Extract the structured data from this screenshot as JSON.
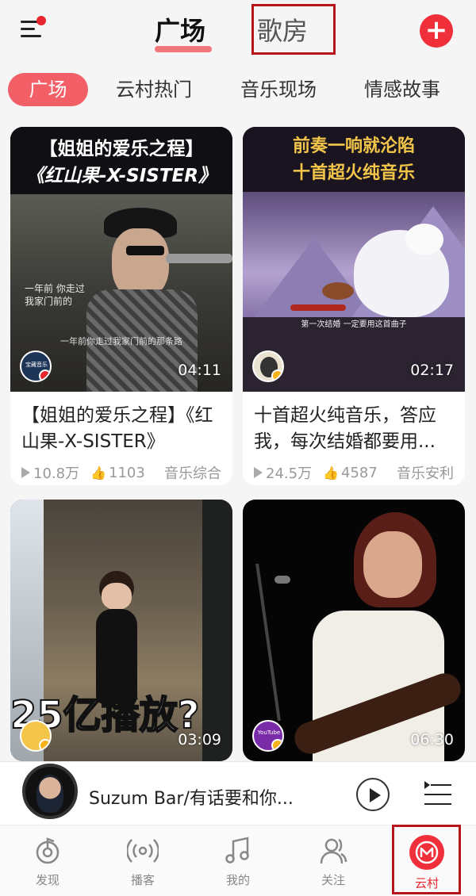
{
  "header": {
    "tab_active": "广场",
    "tab_inactive": "歌房"
  },
  "categories": [
    "广场",
    "云村热门",
    "音乐现场",
    "情感故事"
  ],
  "cards": [
    {
      "overlay_line1": "【姐姐的爱乐之程】",
      "overlay_line2": "《红山果-X-SISTER》",
      "subtitle_lyric1": "一年前 你走过",
      "subtitle_lyric2": "我家门前的",
      "bottom_lyric": "一年前你走过我家门前的那条路",
      "avatar_text": "宝藏音乐",
      "duration": "04:11",
      "title": "【姐姐的爱乐之程】《红山果-X-SISTER》",
      "plays": "10.8万",
      "likes": "1103",
      "category": "音乐综合"
    },
    {
      "overlay_line1": "前奏一响就沦陷",
      "overlay_line2": "十首超火纯音乐",
      "bottom_lyric": "第一次结婚 一定要用这首曲子",
      "duration": "02:17",
      "title": "十首超火纯音乐，答应我，每次结婚都要用...",
      "plays": "24.5万",
      "likes": "4587",
      "category": "音乐安利"
    },
    {
      "overlay_big": "25亿播放?",
      "duration": "03:09"
    },
    {
      "avatar_text": "YouTube",
      "duration": "06:30"
    }
  ],
  "player": {
    "song": "Suzum Bar/有话要和你..."
  },
  "nav": [
    {
      "label": "发现",
      "icon": "discover-icon"
    },
    {
      "label": "播客",
      "icon": "podcast-icon"
    },
    {
      "label": "我的",
      "icon": "music-note-icon"
    },
    {
      "label": "关注",
      "icon": "follow-icon"
    },
    {
      "label": "云村",
      "icon": "village-icon"
    }
  ],
  "colors": {
    "accent": "#ef2f3a",
    "highlight_box": "#b5161c"
  }
}
